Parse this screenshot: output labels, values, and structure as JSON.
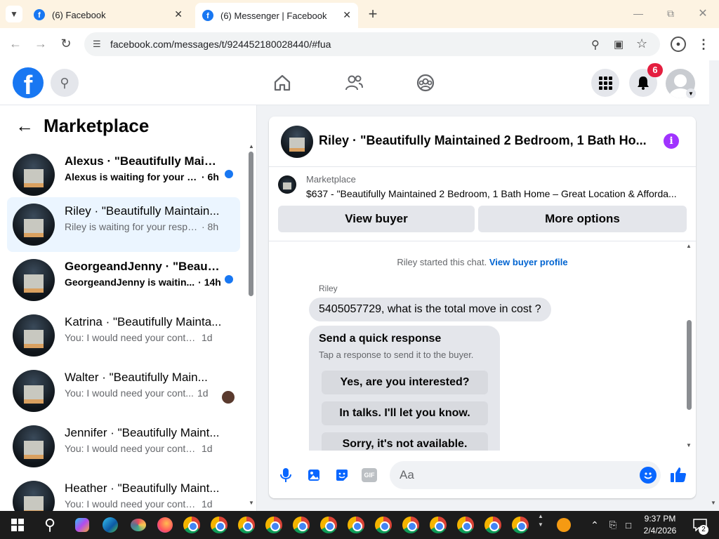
{
  "browser": {
    "tabs": [
      {
        "label": "(6) Facebook"
      },
      {
        "label": "(6) Messenger | Facebook"
      }
    ],
    "url": "facebook.com/messages/t/924452180028440/#fua"
  },
  "fb_header": {
    "notification_count": "6"
  },
  "sidebar": {
    "title": "Marketplace",
    "conversations": [
      {
        "name": "Alexus · \"Beautifully Maint...",
        "preview": "Alexus is waiting for your r...",
        "time": "· 6h",
        "unread": true
      },
      {
        "name": "Riley · \"Beautifully Maintain...",
        "preview": "Riley is waiting for your respo...",
        "time": "· 8h",
        "unread": false
      },
      {
        "name": "GeorgeandJenny · \"Beautif...",
        "preview": "GeorgeandJenny is waitin...",
        "time": "· 14h",
        "unread": true
      },
      {
        "name": "Katrina · \"Beautifully Mainta...",
        "preview": "You: I would need your contact...",
        "time": "1d",
        "unread": false
      },
      {
        "name": "Walter · \"Beautifully Main...",
        "preview": "You: I would need your cont...",
        "time": "1d",
        "unread": false
      },
      {
        "name": "Jennifer · \"Beautifully Maint...",
        "preview": "You: I would need your contact...",
        "time": "1d",
        "unread": false
      },
      {
        "name": "Heather · \"Beautifully Maint...",
        "preview": "You: I would need your contact...",
        "time": "1d",
        "unread": false
      }
    ]
  },
  "chat": {
    "title": "Riley · \"Beautifully Maintained 2 Bedroom, 1 Bath Ho...",
    "listing_source": "Marketplace",
    "listing_text": "$637 - \"Beautifully Maintained 2 Bedroom, 1 Bath Home – Great Location & Afforda...",
    "view_buyer": "View buyer",
    "more_options": "More options",
    "started_text": "Riley started this chat.",
    "buyer_profile_link": "View buyer profile",
    "sender": "Riley",
    "message": "5405057729, what is the total move in cost ?",
    "quick_title": "Send a quick response",
    "quick_subtitle": "Tap a response to send it to the buyer.",
    "quick_responses": [
      "Yes, are you interested?",
      "In talks. I'll let you know.",
      "Sorry, it's not available."
    ],
    "input_placeholder": "Aa"
  },
  "taskbar": {
    "time": "9:37 PM",
    "date": "2/4/2026",
    "notif_badge": "2"
  },
  "colors": {
    "fb_blue": "#1877f2",
    "badge_red": "#e41e3f",
    "info_purple": "#a033ff"
  }
}
